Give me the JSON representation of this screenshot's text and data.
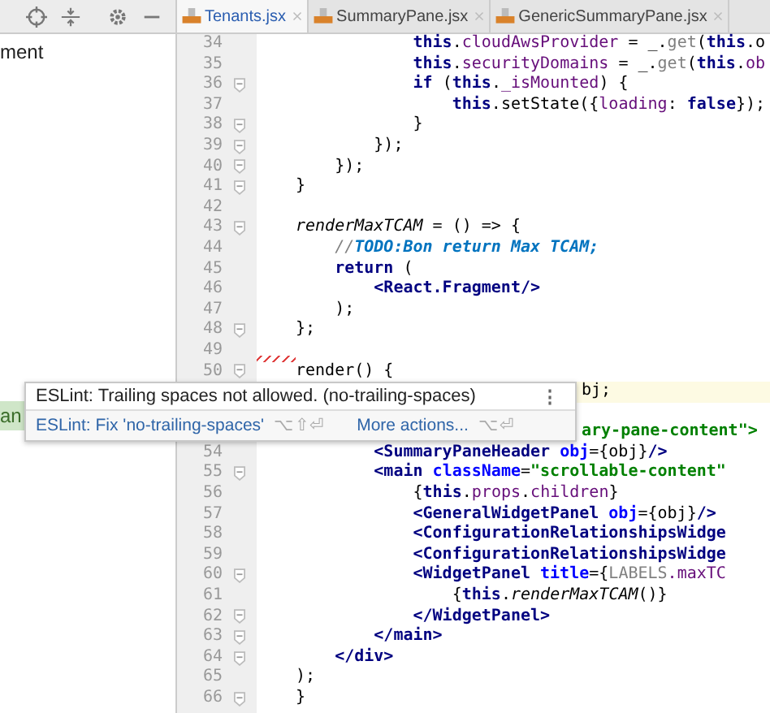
{
  "project_panel": {
    "toolbar": [
      {
        "kind": "locate"
      },
      {
        "kind": "collapse"
      },
      {
        "kind": "settings"
      },
      {
        "kind": "hide"
      }
    ],
    "items": [
      {
        "text": "ment",
        "highlighted": false
      },
      {
        "text": "an",
        "highlighted": true
      }
    ]
  },
  "tabs": [
    {
      "label": "Tenants.jsx",
      "selected": true
    },
    {
      "label": "SummaryPane.jsx",
      "selected": false
    },
    {
      "label": "GenericSummaryPane.jsx",
      "selected": false
    }
  ],
  "lines": [
    {
      "number": "34",
      "fold": false,
      "tokens": [
        {
          "t": "            this",
          "kind": "kw"
        },
        {
          "t": ".",
          "kind": "plain"
        },
        {
          "t": "cloudAwsProvider",
          "kind": "prop"
        },
        {
          "t": " = _.",
          "kind": "plain"
        },
        {
          "t": "get",
          "kind": "muted"
        },
        {
          "t": "(",
          "kind": "plain"
        },
        {
          "t": "this",
          "kind": "kw"
        },
        {
          "t": ".o",
          "kind": "plain"
        }
      ]
    },
    {
      "number": "35",
      "fold": false,
      "tokens": [
        {
          "t": "            this",
          "kind": "kw"
        },
        {
          "t": ".",
          "kind": "plain"
        },
        {
          "t": "securityDomains",
          "kind": "prop"
        },
        {
          "t": " = _.",
          "kind": "plain"
        },
        {
          "t": "get",
          "kind": "muted"
        },
        {
          "t": "(",
          "kind": "plain"
        },
        {
          "t": "this",
          "kind": "kw"
        },
        {
          "t": ".",
          "kind": "plain"
        },
        {
          "t": "ob",
          "kind": "prop"
        }
      ]
    },
    {
      "number": "36",
      "fold": true,
      "tokens": [
        {
          "t": "            if",
          "kind": "kw"
        },
        {
          "t": " (",
          "kind": "plain"
        },
        {
          "t": "this",
          "kind": "kw"
        },
        {
          "t": ".",
          "kind": "plain"
        },
        {
          "t": "_isMounted",
          "kind": "prop"
        },
        {
          "t": ") {",
          "kind": "plain"
        }
      ]
    },
    {
      "number": "37",
      "fold": false,
      "tokens": [
        {
          "t": "                this",
          "kind": "kw"
        },
        {
          "t": ".setState({",
          "kind": "plain"
        },
        {
          "t": "loading",
          "kind": "prop"
        },
        {
          "t": ": ",
          "kind": "plain"
        },
        {
          "t": "false",
          "kind": "kw"
        },
        {
          "t": "});",
          "kind": "plain"
        }
      ]
    },
    {
      "number": "38",
      "fold": true,
      "tokens": [
        {
          "t": "            }",
          "kind": "plain"
        }
      ]
    },
    {
      "number": "39",
      "fold": true,
      "tokens": [
        {
          "t": "        });",
          "kind": "plain"
        }
      ]
    },
    {
      "number": "40",
      "fold": true,
      "tokens": [
        {
          "t": "    });",
          "kind": "plain"
        }
      ]
    },
    {
      "number": "41",
      "fold": true,
      "tokens": [
        {
          "t": "}",
          "kind": "plain"
        }
      ]
    },
    {
      "number": "42",
      "fold": false
    },
    {
      "number": "43",
      "fold": true,
      "tokens": [
        {
          "t": "renderMaxTCAM",
          "kind": "italic"
        },
        {
          "t": " = () => {",
          "kind": "plain"
        }
      ]
    },
    {
      "number": "44",
      "fold": false,
      "tokens": [
        {
          "t": "    //",
          "kind": "comment"
        },
        {
          "t": "TODO:Bon return Max TCAM;",
          "kind": "todo"
        }
      ]
    },
    {
      "number": "45",
      "fold": false,
      "tokens": [
        {
          "t": "    return",
          "kind": "kw"
        },
        {
          "t": " (",
          "kind": "plain"
        }
      ]
    },
    {
      "number": "46",
      "fold": false,
      "tokens": [
        {
          "t": "        <React.Fragment/>",
          "kind": "tag"
        }
      ]
    },
    {
      "number": "47",
      "fold": false,
      "tokens": [
        {
          "t": "    );",
          "kind": "plain"
        }
      ]
    },
    {
      "number": "48",
      "fold": true,
      "tokens": [
        {
          "t": "};",
          "kind": "plain"
        }
      ]
    },
    {
      "number": "49",
      "fold": false,
      "trailing_spaces": true
    },
    {
      "number": "50",
      "fold": true,
      "tokens": [
        {
          "t": "render",
          "kind": "plain"
        },
        {
          "t": "() {",
          "kind": "plain"
        }
      ]
    },
    {
      "current": true,
      "covered": true,
      "tokens": [
        {
          "t": "bj;",
          "kind": "plain"
        }
      ]
    },
    {
      "covered": true,
      "tokens": [
        {
          "t": "ary-pane-content\">",
          "kind": "str"
        }
      ]
    },
    {
      "number": "54",
      "fold": false,
      "tokens": [
        {
          "t": "        <SummaryPaneHeader ",
          "kind": "tag"
        },
        {
          "t": "obj",
          "kind": "attr"
        },
        {
          "t": "={obj}",
          "kind": "plain"
        },
        {
          "t": "/>",
          "kind": "tag"
        }
      ]
    },
    {
      "number": "55",
      "fold": true,
      "tokens": [
        {
          "t": "        <main ",
          "kind": "tag"
        },
        {
          "t": "className",
          "kind": "attr"
        },
        {
          "t": "=",
          "kind": "plain"
        },
        {
          "t": "\"scrollable-content\"",
          "kind": "str"
        }
      ]
    },
    {
      "number": "56",
      "fold": false,
      "tokens": [
        {
          "t": "            {",
          "kind": "plain"
        },
        {
          "t": "this",
          "kind": "kw"
        },
        {
          "t": ".",
          "kind": "plain"
        },
        {
          "t": "props",
          "kind": "prop"
        },
        {
          "t": ".",
          "kind": "plain"
        },
        {
          "t": "children",
          "kind": "prop"
        },
        {
          "t": "}",
          "kind": "plain"
        }
      ]
    },
    {
      "number": "57",
      "fold": false,
      "tokens": [
        {
          "t": "            <GeneralWidgetPanel ",
          "kind": "tag"
        },
        {
          "t": "obj",
          "kind": "attr"
        },
        {
          "t": "={obj}",
          "kind": "plain"
        },
        {
          "t": "/>",
          "kind": "tag"
        }
      ]
    },
    {
      "number": "58",
      "fold": false,
      "tokens": [
        {
          "t": "            <ConfigurationRelationshipsWidge",
          "kind": "tag"
        }
      ]
    },
    {
      "number": "59",
      "fold": false,
      "tokens": [
        {
          "t": "            <ConfigurationRelationshipsWidge",
          "kind": "tag"
        }
      ]
    },
    {
      "number": "60",
      "fold": true,
      "tokens": [
        {
          "t": "            <WidgetPanel ",
          "kind": "tag"
        },
        {
          "t": "title",
          "kind": "attr"
        },
        {
          "t": "={",
          "kind": "plain"
        },
        {
          "t": "LABELS",
          "kind": "muted"
        },
        {
          "t": ".maxTC",
          "kind": "prop"
        }
      ]
    },
    {
      "number": "61",
      "fold": false,
      "tokens": [
        {
          "t": "                {",
          "kind": "plain"
        },
        {
          "t": "this",
          "kind": "kw"
        },
        {
          "t": ".",
          "kind": "plain"
        },
        {
          "t": "renderMaxTCAM",
          "kind": "italic"
        },
        {
          "t": "()}",
          "kind": "plain"
        }
      ]
    },
    {
      "number": "62",
      "fold": true,
      "tokens": [
        {
          "t": "            </WidgetPanel>",
          "kind": "tag"
        }
      ]
    },
    {
      "number": "63",
      "fold": true,
      "tokens": [
        {
          "t": "        </main>",
          "kind": "tag"
        }
      ]
    },
    {
      "number": "64",
      "fold": true,
      "tokens": [
        {
          "t": "    </div>",
          "kind": "tag"
        }
      ]
    },
    {
      "number": "65",
      "fold": false,
      "tokens": [
        {
          "t": ");",
          "kind": "plain"
        }
      ]
    },
    {
      "number": "66",
      "fold": true,
      "tokens": [
        {
          "t": "}",
          "kind": "plain"
        }
      ]
    }
  ],
  "popup": {
    "message": "ESLint: Trailing spaces not allowed. (no-trailing-spaces)",
    "menu": "⋮",
    "fix": "ESLint: Fix 'no-trailing-spaces'",
    "fix_shortcut": "⌥⇧⏎",
    "more": "More actions...",
    "more_shortcut": "⌥⏎"
  }
}
